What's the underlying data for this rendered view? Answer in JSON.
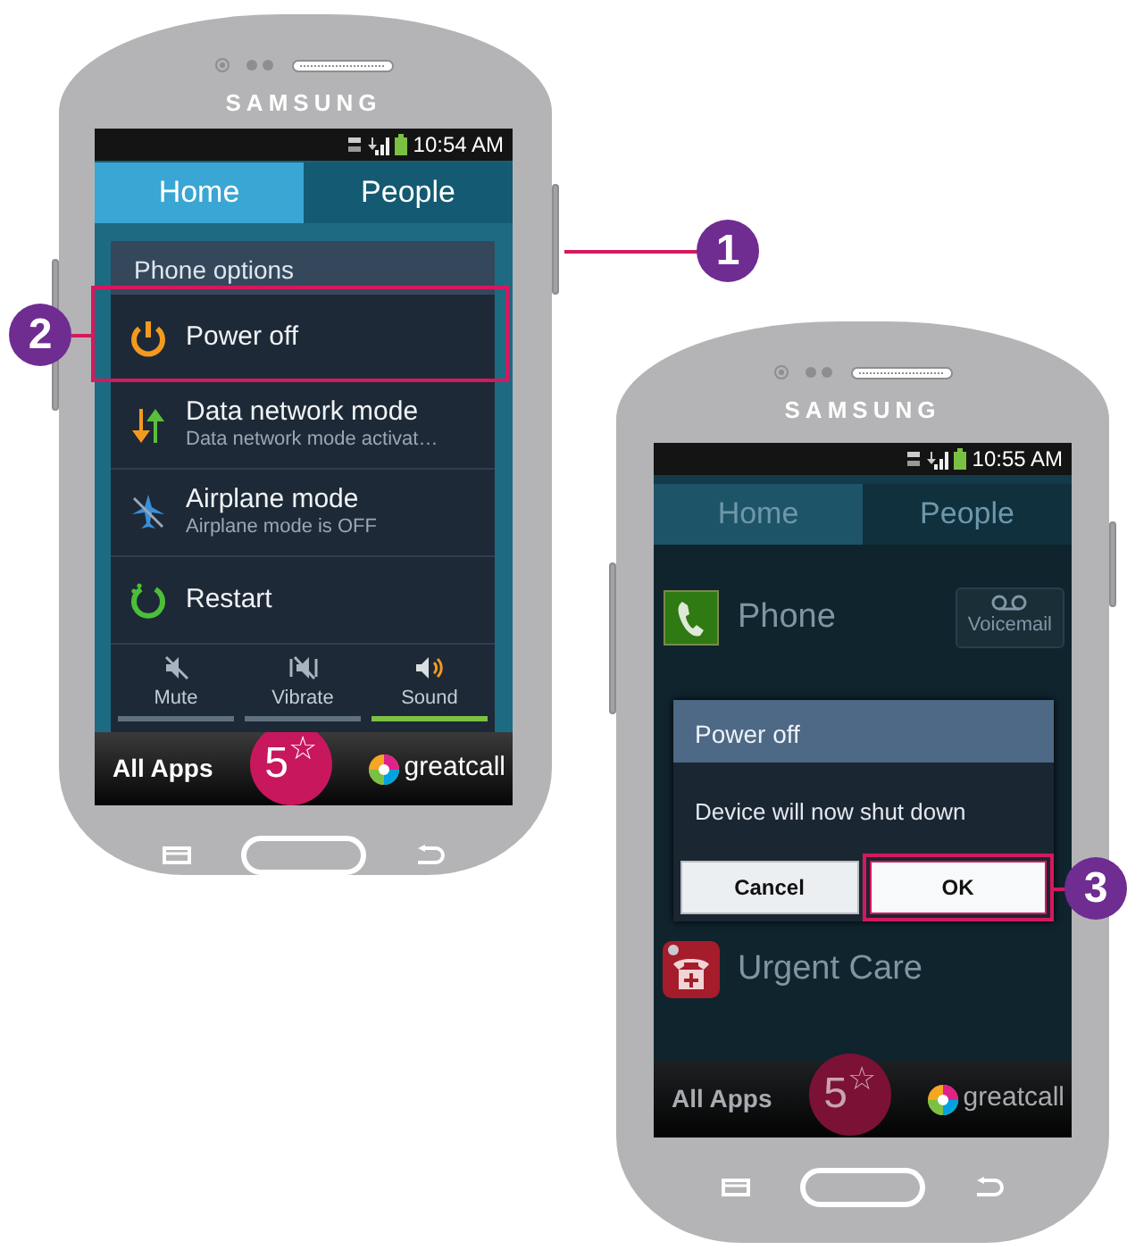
{
  "phones": [
    {
      "brand": "SAMSUNG",
      "time": "10:54 AM",
      "tabs": [
        {
          "label": "Home",
          "selected": true
        },
        {
          "label": "People",
          "selected": false
        }
      ],
      "screen": {
        "kind": "options_menu",
        "title": "Phone options",
        "items": [
          {
            "kind": "power",
            "label": "Power off",
            "highlighted": true
          },
          {
            "kind": "data",
            "label": "Data network mode",
            "subtitle": "Data network mode activat…",
            "highlighted": false
          },
          {
            "kind": "airplane",
            "label": "Airplane mode",
            "subtitle": "Airplane mode is OFF",
            "highlighted": false
          },
          {
            "kind": "restart",
            "label": "Restart",
            "highlighted": false
          }
        ],
        "sound_modes": [
          {
            "kind": "mute",
            "label": "Mute",
            "selected": false
          },
          {
            "kind": "vibrate",
            "label": "Vibrate",
            "selected": false
          },
          {
            "kind": "sound",
            "label": "Sound",
            "selected": true
          }
        ]
      },
      "dock": {
        "all_apps": "All Apps",
        "five_star": "5$^{☆}$",
        "brand": "greatcall"
      }
    },
    {
      "brand": "SAMSUNG",
      "time": "10:55 AM",
      "tabs": [
        {
          "label": "Home",
          "selected": true
        },
        {
          "label": "People",
          "selected": false
        }
      ],
      "screen": {
        "kind": "dialog",
        "apps": [
          {
            "kind": "phone",
            "label": "Phone",
            "action": "Voicemail"
          },
          {
            "kind": "urgent",
            "label": "Urgent Care"
          }
        ],
        "dialog": {
          "title": "Power off",
          "message": "Device will now shut down",
          "buttons": [
            {
              "label": "Cancel",
              "highlighted": false
            },
            {
              "label": "OK",
              "highlighted": true
            }
          ]
        }
      },
      "dock": {
        "all_apps": "All Apps",
        "five_star": "5$^{☆}$",
        "brand": "greatcall"
      }
    }
  ],
  "callouts": [
    "1",
    "2",
    "3"
  ]
}
